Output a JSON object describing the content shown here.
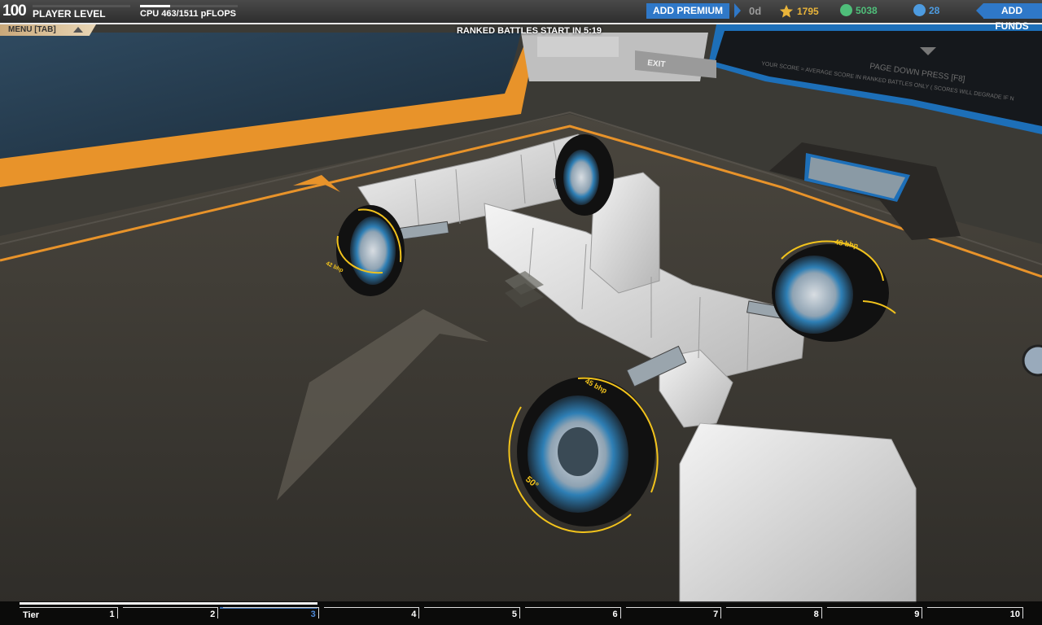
{
  "hud": {
    "player_level": "100",
    "player_level_label": "PLAYER LEVEL",
    "player_level_progress": 0,
    "cpu_label": "CPU 463/1511 pFLOPS",
    "cpu_used": 463,
    "cpu_max": 1511,
    "add_premium_label": "ADD PREMIUM",
    "premium_days": "0d",
    "robits": "1795",
    "rp": "5038",
    "gc": "28",
    "add_funds_label": "ADD FUNDS",
    "menu_label": "MENU [TAB]",
    "ranked_label": "RANKED BATTLES START IN 5:19"
  },
  "colors": {
    "accent_blue": "#2f78c8",
    "robits_gold": "#e9b43a",
    "rp_green": "#4fbf7a",
    "gc_blue": "#4d9be0",
    "rim_orange": "#e8932a",
    "annotation_yellow": "#f2c31c"
  },
  "scene": {
    "exit_label": "EXIT",
    "screen_line1": "PAGE DOWN PRESS [F8]",
    "screen_line2": "YOUR SCORE = AVERAGE SCORE IN RANKED BATTLES ONLY ( SCORES WILL DEGRADE IF N",
    "wheel_labels": [
      "42 bhp",
      "48 bhp",
      "45 bhp",
      "50°"
    ]
  },
  "tiers": {
    "label": "Tier",
    "numbers": [
      "1",
      "2",
      "3",
      "4",
      "5",
      "6",
      "7",
      "8",
      "9",
      "10"
    ],
    "current": "3"
  },
  "icons": {
    "robits": "star-icon",
    "rp": "rp-icon",
    "gc": "gc-icon",
    "menu": "triangle-up-icon",
    "crosshair": "crosshair-icon"
  }
}
